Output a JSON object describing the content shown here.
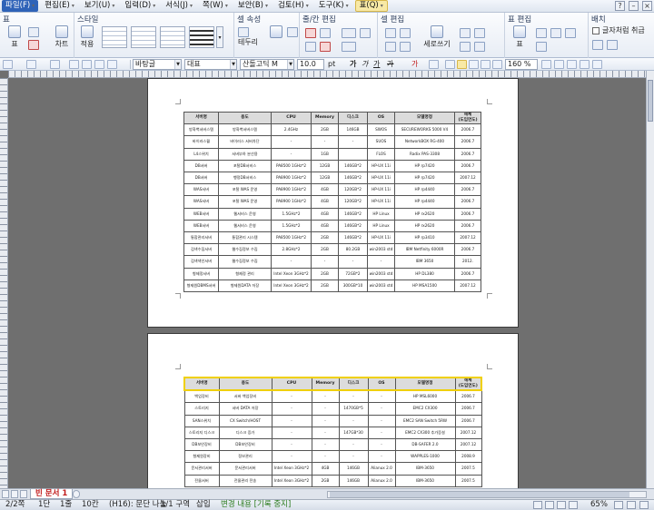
{
  "menubar": {
    "items": [
      {
        "label": "파일(F)",
        "active": false
      },
      {
        "label": "편집(E)"
      },
      {
        "label": "보기(U)"
      },
      {
        "label": "입력(D)"
      },
      {
        "label": "서식(J)"
      },
      {
        "label": "쪽(W)"
      },
      {
        "label": "보안(B)"
      },
      {
        "label": "검토(H)"
      },
      {
        "label": "도구(K)"
      },
      {
        "label": "표(Q)"
      }
    ]
  },
  "ribbon": {
    "groups": {
      "table": "표",
      "style": "스타일",
      "cell_attr": "셀 속성",
      "row_col_edit": "줄/칸 편집",
      "cell_edit": "셀 편집",
      "table_edit": "표 편집",
      "layout": "배치"
    },
    "buttons": {
      "table_props": "표\n만들기",
      "chart": "차트",
      "apply_options": "적용\n옵션",
      "border": "테두리",
      "fill": "채우기",
      "vertical_write": "세로쓰기",
      "table_options": "표\n여백"
    },
    "layout_checks": [
      "글자처럼 취급",
      "배치"
    ]
  },
  "formatbar": {
    "style": "바탕글",
    "lang": "대표",
    "font": "산돌고딕 M",
    "size": "10.0",
    "size_unit": "pt",
    "zoom": "160 %"
  },
  "document": {
    "columns": [
      "서버명",
      "용도",
      "CPU",
      "Memory",
      "디스크",
      "OS",
      "모델명정",
      "해체\n(도입연도)"
    ],
    "page1_rows": [
      [
        "방화벽서버스템",
        "방화벽서버스템",
        "2.4GHz",
        "2GB",
        "146GB",
        "SWOS",
        "SECUREWORKS 5000 V4",
        "2006.7"
      ],
      [
        "바이러스월",
        "바이러스 서버차단",
        "-",
        "-",
        "-",
        "SUOS",
        "NetworkBOX RG-400",
        "2006.7"
      ],
      [
        "L4스위치",
        "서버부하 분산용",
        "-",
        "1GB",
        "",
        "FLOS",
        "Radix PAS-3308",
        "2006.7"
      ],
      [
        "DB서버",
        "포탈DB서비스",
        "PA8500 1GHz*2",
        "12GB",
        "146GB*2",
        "HP-UX 11i",
        "HP rp7420",
        "2006.7"
      ],
      [
        "DB서버",
        "행정DB서비스",
        "PA8900 1GHz*2",
        "12GB",
        "146GB*2",
        "HP-UX 11i",
        "HP rp7420",
        "2007.12"
      ],
      [
        "WAS서버",
        "포탈 WAS 운영",
        "PA8900 1GHz*2",
        "4GB",
        "120GB*2",
        "HP-UX 11i",
        "HP rp4440",
        "2006.7"
      ],
      [
        "WAS서버",
        "포탈 WAS 운영",
        "PA8900 1GHz*2",
        "4GB",
        "120GB*2",
        "HP-UX 11i",
        "HP rp4440",
        "2006.7"
      ],
      [
        "WEB서버",
        "웹서비스 운영",
        "1.5GHz*2",
        "4GB",
        "146GB*2",
        "HP Linux",
        "HP rx2620",
        "2006.7"
      ],
      [
        "WEB서버",
        "웹서비스 운영",
        "1.5GHz*2",
        "4GB",
        "146GB*2",
        "HP Linux",
        "HP rx2620",
        "2006.7"
      ],
      [
        "통합관리서버",
        "통합관리 시스템",
        "PA8500 1GHz*2",
        "2GB",
        "146GB*2",
        "HP-UX 11i",
        "HP rp3410",
        "2007.12"
      ],
      [
        "검색수집서버",
        "웹수집정보 수집",
        "2.8GHz*2",
        "2GB",
        "80.2GB",
        "win2003 std",
        "IBM Netfinity 6000R",
        "2006.7"
      ],
      [
        "검색색인서버",
        "웹수집정보 수집",
        "-",
        "-",
        "-",
        "-",
        "IBM 3650",
        "2012."
      ],
      [
        "형제정서버",
        "형제정 관리",
        "Intel Xeon 3GHz*2",
        "2GB",
        "72GB*2",
        "win2003 std",
        "HP DL380",
        "2006.7"
      ],
      [
        "형제원DBMS서버",
        "형제원DATA 저장",
        "Intel Xeon 3GHz*2",
        "2GB",
        "300GB*10",
        "win2003 std",
        "HP MSA1500",
        "2007.12"
      ]
    ],
    "page2_rows": [
      [
        "백업장비",
        "서버 백업장비",
        "-",
        "-",
        "-",
        "-",
        "HP MSL6000",
        "2006.7"
      ],
      [
        "스토리지",
        "서버 DATA 저장",
        "-",
        "-",
        "1470GB*5",
        "-",
        "EMC2 CX300",
        "2006.7"
      ],
      [
        "SAN스위치",
        "CX Switch/HOST",
        "-",
        "-",
        "-",
        "-",
        "EMC2 SAN Switch 5RW",
        "2006.7"
      ],
      [
        "스토리지 디스크",
        "디스크 증가",
        "-",
        "-",
        "147GB*30",
        "-",
        "EMC2 CX300 추가증설",
        "2007.12"
      ],
      [
        "DB보안장비",
        "DB보안장비",
        "-",
        "-",
        "-",
        "-",
        "DB-SAFER 2.0",
        "2007.12"
      ],
      [
        "형제원장비",
        "정보관리",
        "-",
        "-",
        "-",
        "-",
        "WAPPLES-1000",
        "2008.9"
      ],
      [
        "문서관리서버",
        "문서관리서버",
        "Intel Xeon 3GHz*2",
        "4GB",
        "146GB",
        "Alianux 2.0",
        "IBM-3650",
        "2007.5"
      ],
      [
        "전물서버",
        "전물관리 전송",
        "Intel Xeon 3GHz*2",
        "2GB",
        "146GB",
        "Alianux 2.0",
        "IBM-3650",
        "2007.5"
      ]
    ]
  },
  "tabbar": {
    "doc_tab": "빈 문서 1"
  },
  "statusbar": {
    "page": "2/2쪽",
    "section": "1단",
    "line": "1줄",
    "col": "10칸",
    "cell_info": "(H16): 문단 나눔",
    "section_no": "1/1 구역",
    "insert": "삽입",
    "track": "변경 내용 [기록 중지]",
    "zoom": "65%"
  }
}
